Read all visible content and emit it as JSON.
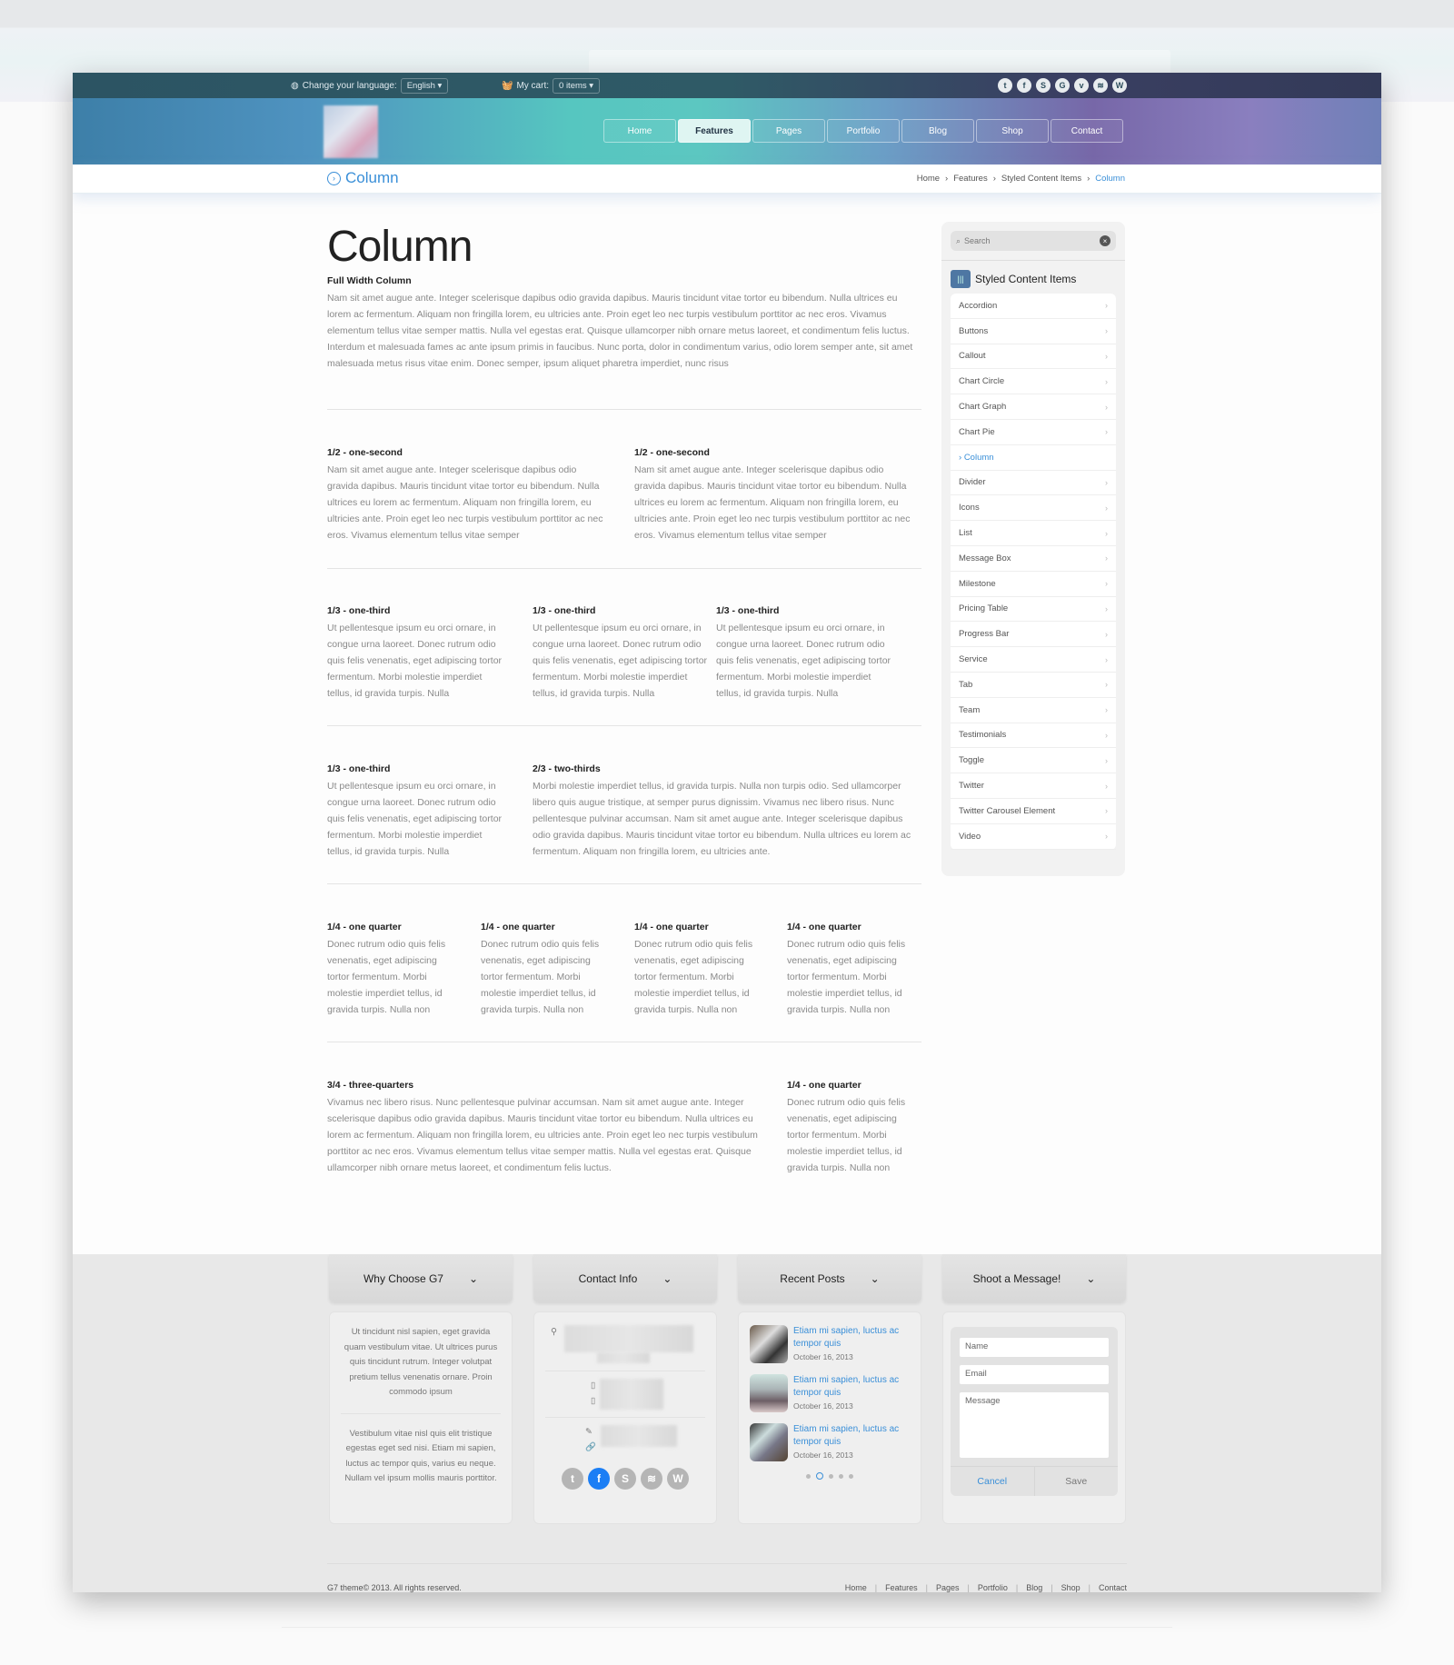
{
  "topbar": {
    "language_label": "Change your language:",
    "language_value": "English",
    "cart_label": "My cart:",
    "cart_value": "0 items",
    "socials": [
      "twitter",
      "facebook",
      "skype",
      "google",
      "vimeo",
      "rss",
      "wordpress"
    ]
  },
  "nav": [
    "Home",
    "Features",
    "Pages",
    "Portfolio",
    "Blog",
    "Shop",
    "Contact"
  ],
  "nav_active": "Features",
  "titlebar": {
    "title": "Column"
  },
  "breadcrumb": [
    "Home",
    "Features",
    "Styled Content Items",
    "Column"
  ],
  "main": {
    "title": "Column",
    "full": {
      "heading": "Full Width Column",
      "text": "Nam sit amet augue ante. Integer scelerisque dapibus odio gravida dapibus. Mauris tincidunt vitae tortor eu bibendum. Nulla ultrices eu lorem ac fermentum. Aliquam non fringilla lorem, eu ultricies ante. Proin eget leo nec turpis vestibulum porttitor ac nec eros. Vivamus elementum tellus vitae semper mattis. Nulla vel egestas erat. Quisque ullamcorper nibh ornare metus laoreet, et condimentum felis luctus. Interdum et malesuada fames ac ante ipsum primis in faucibus. Nunc porta, dolor in condimentum varius, odio lorem semper ante, sit amet malesuada metus risus vitae enim. Donec semper, ipsum aliquet pharetra imperdiet, nunc risus"
    },
    "half": [
      {
        "heading": "1/2 - one-second",
        "text": "Nam sit amet augue ante. Integer scelerisque dapibus odio gravida dapibus. Mauris tincidunt vitae tortor eu bibendum. Nulla ultrices eu lorem ac fermentum. Aliquam non fringilla lorem, eu ultricies ante. Proin eget leo nec turpis vestibulum porttitor ac nec eros. Vivamus elementum tellus vitae semper"
      },
      {
        "heading": "1/2 - one-second",
        "text": "Nam sit amet augue ante. Integer scelerisque dapibus odio gravida dapibus. Mauris tincidunt vitae tortor eu bibendum. Nulla ultrices eu lorem ac fermentum. Aliquam non fringilla lorem, eu ultricies ante. Proin eget leo nec turpis vestibulum porttitor ac nec eros. Vivamus elementum tellus vitae semper"
      }
    ],
    "third": [
      {
        "heading": "1/3 - one-third",
        "text": "Ut pellentesque ipsum eu orci ornare, in congue urna laoreet. Donec rutrum odio quis felis venenatis, eget adipiscing tortor fermentum. Morbi molestie imperdiet tellus, id gravida turpis. Nulla"
      },
      {
        "heading": "1/3 - one-third",
        "text": "Ut pellentesque ipsum eu orci ornare, in congue urna laoreet. Donec rutrum odio quis felis venenatis, eget adipiscing tortor fermentum. Morbi molestie imperdiet tellus, id gravida turpis. Nulla"
      },
      {
        "heading": "1/3 - one-third",
        "text": "Ut pellentesque ipsum eu orci ornare, in congue urna laoreet. Donec rutrum odio quis felis venenatis, eget adipiscing tortor fermentum. Morbi molestie imperdiet tellus, id gravida turpis. Nulla"
      }
    ],
    "third_two": [
      {
        "heading": "1/3 - one-third",
        "text": "Ut pellentesque ipsum eu orci ornare, in congue urna laoreet. Donec rutrum odio quis felis venenatis, eget adipiscing tortor fermentum. Morbi molestie imperdiet tellus, id gravida turpis. Nulla"
      },
      {
        "heading": "2/3 - two-thirds",
        "text": "Morbi molestie imperdiet tellus, id gravida turpis. Nulla non turpis odio. Sed ullamcorper libero quis augue tristique, at semper purus dignissim. Vivamus nec libero risus. Nunc pellentesque pulvinar accumsan. Nam sit amet augue ante. Integer scelerisque dapibus odio gravida dapibus. Mauris tincidunt vitae tortor eu bibendum. Nulla ultrices eu lorem ac fermentum. Aliquam non fringilla lorem, eu ultricies ante."
      }
    ],
    "quarter": [
      {
        "heading": "1/4 - one quarter",
        "text": "Donec rutrum odio quis felis venenatis, eget adipiscing tortor fermentum. Morbi molestie imperdiet tellus, id gravida turpis. Nulla non"
      },
      {
        "heading": "1/4 - one quarter",
        "text": "Donec rutrum odio quis felis venenatis, eget adipiscing tortor fermentum. Morbi molestie imperdiet tellus, id gravida turpis. Nulla non"
      },
      {
        "heading": "1/4 - one quarter",
        "text": "Donec rutrum odio quis felis venenatis, eget adipiscing tortor fermentum. Morbi molestie imperdiet tellus, id gravida turpis. Nulla non"
      },
      {
        "heading": "1/4 - one quarter",
        "text": "Donec rutrum odio quis felis venenatis, eget adipiscing tortor fermentum. Morbi molestie imperdiet tellus, id gravida turpis. Nulla non"
      }
    ],
    "three_quarter": [
      {
        "heading": "3/4 - three-quarters",
        "text": "Vivamus nec libero risus. Nunc pellentesque pulvinar accumsan. Nam sit amet augue ante. Integer scelerisque dapibus odio gravida dapibus. Mauris tincidunt vitae tortor eu bibendum. Nulla ultrices eu lorem ac fermentum. Aliquam non fringilla lorem, eu ultricies ante. Proin eget leo nec turpis vestibulum porttitor ac nec eros. Vivamus elementum tellus vitae semper mattis. Nulla vel egestas erat. Quisque ullamcorper nibh ornare metus laoreet, et condimentum felis luctus."
      },
      {
        "heading": "1/4 - one quarter",
        "text": "Donec rutrum odio quis felis venenatis, eget adipiscing tortor fermentum. Morbi molestie imperdiet tellus, id gravida turpis. Nulla non"
      }
    ]
  },
  "sidebar": {
    "search_placeholder": "Search",
    "title": "Styled Content Items",
    "items": [
      "Accordion",
      "Buttons",
      "Callout",
      "Chart Circle",
      "Chart Graph",
      "Chart Pie",
      "Column",
      "Divider",
      "Icons",
      "List",
      "Message Box",
      "Milestone",
      "Pricing Table",
      "Progress Bar",
      "Service",
      "Tab",
      "Team",
      "Testimonials",
      "Toggle",
      "Twitter",
      "Twitter Carousel Element",
      "Video"
    ],
    "active": "Column"
  },
  "footer": {
    "why": {
      "title": "Why Choose G7",
      "p1": "Ut tincidunt nisl sapien, eget gravida quam vestibulum vitae. Ut ultrices purus quis tincidunt rutrum. Integer volutpat pretium tellus venenatis ornare. Proin commodo ipsum",
      "p2": "Vestibulum vitae nisl quis elit tristique egestas eget sed nisi. Etiam mi sapien, luctus ac tempor quis, varius eu neque. Nullam vel ipsum mollis mauris porttitor."
    },
    "contact": {
      "title": "Contact Info",
      "socials": [
        "twitter",
        "facebook",
        "skype",
        "rss",
        "wordpress"
      ]
    },
    "posts": {
      "title": "Recent Posts",
      "items": [
        {
          "title": "Etiam mi sapien, luctus ac tempor quis",
          "date": "October 16, 2013"
        },
        {
          "title": "Etiam mi sapien, luctus ac tempor quis",
          "date": "October 16, 2013"
        },
        {
          "title": "Etiam mi sapien, luctus ac tempor quis",
          "date": "October 16, 2013"
        }
      ],
      "page_count": 5,
      "current_page": 2
    },
    "message": {
      "title": "Shoot a Message!",
      "name_placeholder": "Name",
      "email_placeholder": "Email",
      "message_placeholder": "Message",
      "cancel": "Cancel",
      "save": "Save"
    },
    "copyright": "G7 theme© 2013. All rights reserved.",
    "links": [
      "Home",
      "Features",
      "Pages",
      "Portfolio",
      "Blog",
      "Shop",
      "Contact"
    ]
  },
  "colors": {
    "accent": "#3a8fd8",
    "facebook": "#1b7ef5",
    "topbar": "#2c5463"
  }
}
